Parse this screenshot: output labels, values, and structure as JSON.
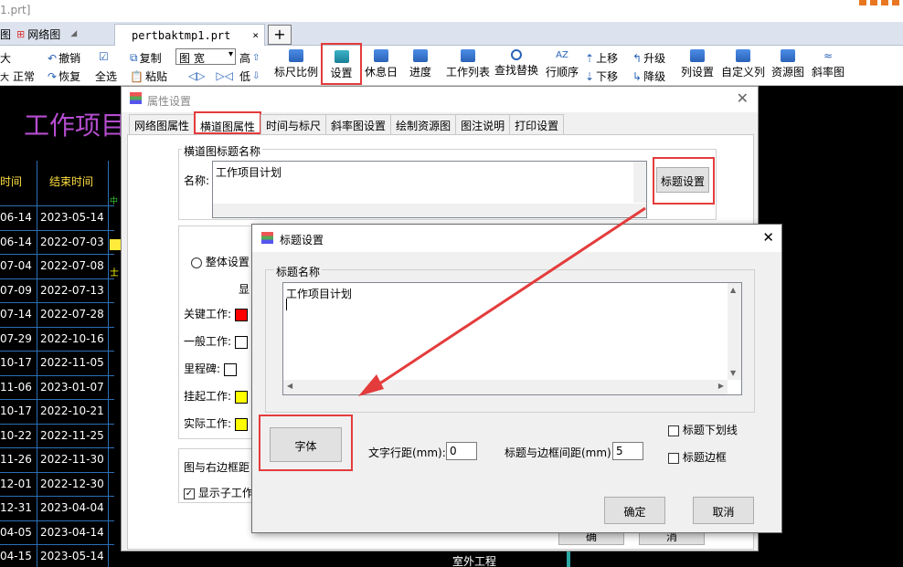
{
  "window": {
    "title_fragment": "1.prt]"
  },
  "tabstrip": {
    "left_item": "图",
    "network_tab": "网络图",
    "doc_tab": "pertbaktmp1.prt",
    "doc_close": "×",
    "new_tab": "+"
  },
  "toolbar": {
    "col1": [
      "大",
      "正常"
    ],
    "undo": "撤销",
    "redo": "恢复",
    "copy": "复制",
    "select_all": "全选",
    "paste": "粘贴",
    "width_combo": "图 宽",
    "high": "高",
    "low": "低",
    "ruler_scale": "标尺比例",
    "settings": "设置",
    "holiday": "休息日",
    "progress": "进度",
    "work_list": "工作列表",
    "find_replace": "查找替换",
    "row_order": "行顺序",
    "move_up": "上移",
    "move_down": "下移",
    "promote": "升级",
    "demote": "降级",
    "column_settings": "列设置",
    "custom_column": "自定义列",
    "resource_chart": "资源图",
    "slope_chart": "斜率图"
  },
  "sheet": {
    "title": "工作项目",
    "header_time": "时间",
    "header_end": "结束时间",
    "rows": [
      [
        "06-14",
        "2023-05-14"
      ],
      [
        "06-14",
        "2022-07-03"
      ],
      [
        "07-04",
        "2022-07-08"
      ],
      [
        "07-09",
        "2022-07-13"
      ],
      [
        "07-14",
        "2022-07-28"
      ],
      [
        "07-29",
        "2022-10-16"
      ],
      [
        "10-17",
        "2022-11-05"
      ],
      [
        "11-06",
        "2023-01-07"
      ],
      [
        "10-17",
        "2022-10-21"
      ],
      [
        "10-22",
        "2022-11-25"
      ],
      [
        "11-26",
        "2022-11-30"
      ],
      [
        "12-01",
        "2022-12-30"
      ],
      [
        "12-31",
        "2023-04-04"
      ],
      [
        "04-05",
        "2023-04-14"
      ],
      [
        "04-15",
        "2023-05-14"
      ]
    ],
    "bottom_label": "室外工程"
  },
  "props_dialog": {
    "title": "属性设置",
    "close": "✕",
    "tabs": [
      "网络图属性",
      "横道图属性",
      "时间与标尺",
      "斜率图设置",
      "绘制资源图",
      "图注说明",
      "打印设置"
    ],
    "group_title": "横道图标题名称",
    "name_label": "名称:",
    "name_value": "工作项目计划",
    "title_settings_btn": "标题设置",
    "radio_whole": "整体设置",
    "display_label": "显",
    "work_labels": [
      "关键工作:",
      "一般工作:",
      "里程碑:",
      "挂起工作:",
      "实际工作:"
    ],
    "work_colors": [
      "#ff0000",
      "#ffffff",
      "#ffffff",
      "#ffff00",
      "#ffff00"
    ],
    "right_margin_label": "图与右边框距",
    "show_subwork": "显示子工作",
    "ok_fragment": "确",
    "cancel_fragment": "消"
  },
  "title_dialog": {
    "title": "标题设置",
    "close": "✕",
    "group_title": "标题名称",
    "title_value": "工作项目计划",
    "font_btn": "字体",
    "line_spacing_label": "文字行距(mm):",
    "line_spacing_value": "0",
    "border_spacing_label": "标题与边框间距(mm):",
    "border_spacing_value": "5",
    "underline_label": "标题下划线",
    "border_label": "标题边框",
    "ok": "确定",
    "cancel": "取消"
  }
}
